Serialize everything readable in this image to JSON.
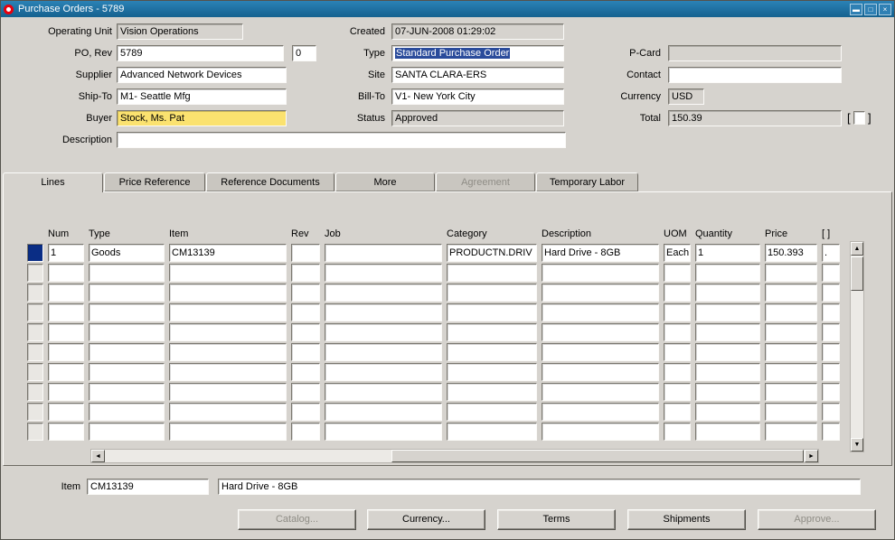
{
  "window": {
    "title": "Purchase Orders - 5789",
    "minimize_glyph": "▬",
    "maximize_glyph": "□",
    "close_glyph": "×"
  },
  "header": {
    "operating_unit": {
      "label": "Operating Unit",
      "value": "Vision Operations"
    },
    "po": {
      "label": "PO, Rev",
      "value": "5789",
      "rev": "0"
    },
    "supplier": {
      "label": "Supplier",
      "value": "Advanced Network Devices"
    },
    "ship_to": {
      "label": "Ship-To",
      "value": "M1- Seattle Mfg"
    },
    "buyer": {
      "label": "Buyer",
      "value": "Stock, Ms. Pat"
    },
    "description": {
      "label": "Description",
      "value": ""
    },
    "created": {
      "label": "Created",
      "value": "07-JUN-2008 01:29:02"
    },
    "type": {
      "label": "Type",
      "value": "Standard Purchase Order"
    },
    "site": {
      "label": "Site",
      "value": "SANTA CLARA-ERS"
    },
    "bill_to": {
      "label": "Bill-To",
      "value": "V1- New York City"
    },
    "status": {
      "label": "Status",
      "value": "Approved"
    },
    "p_card": {
      "label": "P-Card",
      "value": ""
    },
    "contact": {
      "label": "Contact",
      "value": ""
    },
    "currency": {
      "label": "Currency",
      "value": "USD"
    },
    "total": {
      "label": "Total",
      "value": "150.39",
      "bracket_open": "[",
      "bracket_close": "]"
    }
  },
  "tabs": [
    {
      "label": "Lines"
    },
    {
      "label": "Price Reference"
    },
    {
      "label": "Reference Documents"
    },
    {
      "label": "More"
    },
    {
      "label": "Agreement"
    },
    {
      "label": "Temporary Labor"
    }
  ],
  "table": {
    "columns": [
      "Num",
      "Type",
      "Item",
      "Rev",
      "Job",
      "Category",
      "Description",
      "UOM",
      "Quantity",
      "Price",
      "[ ]"
    ],
    "rows": [
      {
        "num": "1",
        "type": "Goods",
        "item": "CM13139",
        "rev": "",
        "job": "",
        "category": "PRODUCTN.DRIV",
        "description": "Hard Drive - 8GB",
        "uom": "Each",
        "quantity": "1",
        "price": "150.393",
        "flag": "."
      }
    ],
    "empty_rows": 9
  },
  "footer": {
    "item_label": "Item",
    "item_value": "CM13139",
    "item_description": "Hard Drive - 8GB"
  },
  "buttons": [
    {
      "label": "Catalog...",
      "disabled": true
    },
    {
      "label": "Currency...",
      "disabled": false
    },
    {
      "label": "Terms",
      "disabled": false
    },
    {
      "label": "Shipments",
      "disabled": false
    },
    {
      "label": "Approve...",
      "disabled": true
    }
  ],
  "scrollbar": {
    "up": "▲",
    "down": "▼",
    "left": "◄",
    "right": "►"
  },
  "colors": {
    "titlebar": "#15618f",
    "selection": "#2a4b9b",
    "row_selector": "#0a2d85",
    "required_yellow": "#fbe26f",
    "readonly_gray": "#d6d3ce"
  }
}
